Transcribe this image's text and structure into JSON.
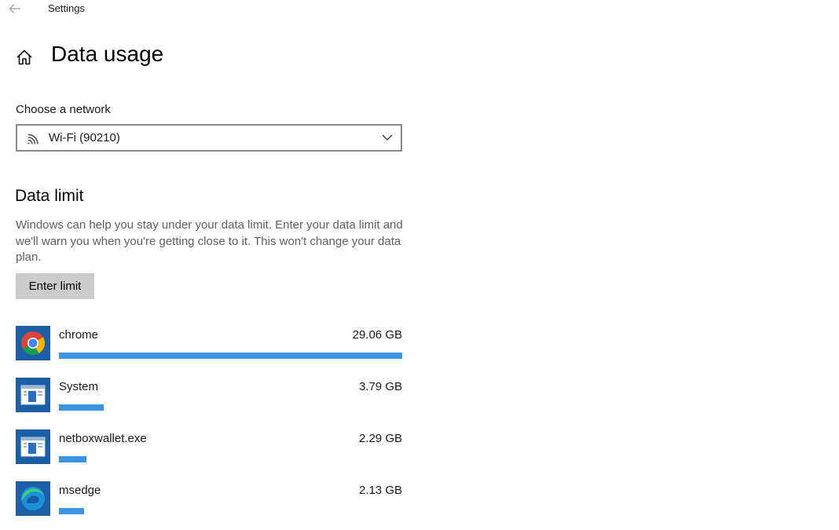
{
  "window": {
    "title": "Settings"
  },
  "page": {
    "title": "Data usage"
  },
  "network": {
    "label": "Choose a network",
    "selected": "Wi-Fi (90210)"
  },
  "data_limit": {
    "title": "Data limit",
    "description": "Windows can help you stay under your data limit. Enter your data limit and we'll warn you when you're getting close to it. This won't change your data plan.",
    "button_label": "Enter limit"
  },
  "apps": [
    {
      "name": "chrome",
      "usage": "29.06 GB",
      "usage_fraction": 1.0,
      "icon": "chrome-icon"
    },
    {
      "name": "System",
      "usage": "3.79 GB",
      "usage_fraction": 0.13,
      "icon": "system-window-icon"
    },
    {
      "name": "netboxwallet.exe",
      "usage": "2.29 GB",
      "usage_fraction": 0.08,
      "icon": "system-window-icon"
    },
    {
      "name": "msedge",
      "usage": "2.13 GB",
      "usage_fraction": 0.073,
      "icon": "edge-icon"
    }
  ],
  "colors": {
    "accent": "#3c94e4",
    "button_bg": "#cccccc",
    "icon_tile": "#1b5fa6"
  }
}
